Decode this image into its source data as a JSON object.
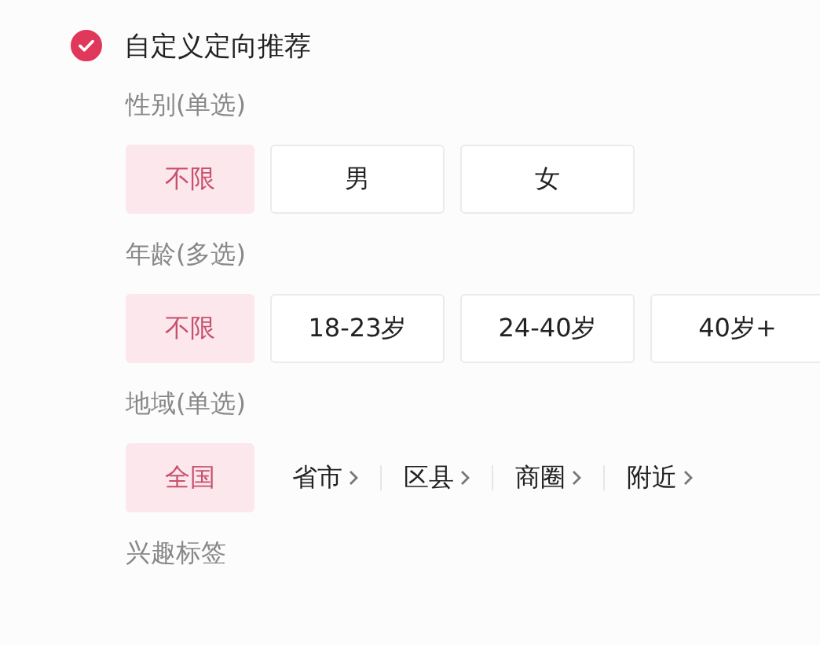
{
  "header": {
    "title": "自定义定向推荐",
    "checked": true
  },
  "sections": [
    {
      "label": "性别(单选)",
      "kind": "boxes",
      "options": [
        {
          "label": "不限",
          "selected": true
        },
        {
          "label": "男",
          "selected": false
        },
        {
          "label": "女",
          "selected": false
        }
      ]
    },
    {
      "label": "年龄(多选)",
      "kind": "boxes",
      "options": [
        {
          "label": "不限",
          "selected": true
        },
        {
          "label": "18-23岁",
          "selected": false
        },
        {
          "label": "24-40岁",
          "selected": false
        },
        {
          "label": "40岁+",
          "selected": false
        }
      ]
    },
    {
      "label": "地域(单选)",
      "kind": "links",
      "options": [
        {
          "label": "全国",
          "selected": true,
          "expandable": false
        },
        {
          "label": "省市",
          "selected": false,
          "expandable": true
        },
        {
          "label": "区县",
          "selected": false,
          "expandable": true
        },
        {
          "label": "商圈",
          "selected": false,
          "expandable": true
        },
        {
          "label": "附近",
          "selected": false,
          "expandable": true
        }
      ]
    },
    {
      "label": "兴趣标签",
      "kind": "heading"
    }
  ]
}
